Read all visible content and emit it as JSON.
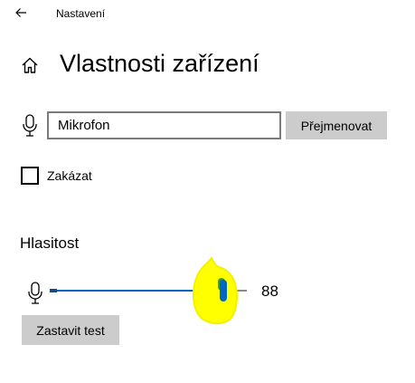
{
  "app": {
    "title": "Nastavení"
  },
  "page": {
    "title": "Vlastnosti zařízení"
  },
  "device": {
    "name_value": "Mikrofon",
    "rename_label": "Přejmenovat"
  },
  "disable": {
    "label": "Zakázat",
    "checked": false
  },
  "volume": {
    "heading": "Hlasitost",
    "value": "88",
    "level": 88,
    "stop_test_label": "Zastavit test"
  },
  "icons": {
    "back": "back-arrow-icon",
    "home": "home-icon",
    "microphone": "microphone-icon"
  },
  "colors": {
    "accent": "#0067c0",
    "button_bg": "#cccccc",
    "highlight_annotation": "#ffff00",
    "thumb_annotation": "#2e9e3e"
  }
}
